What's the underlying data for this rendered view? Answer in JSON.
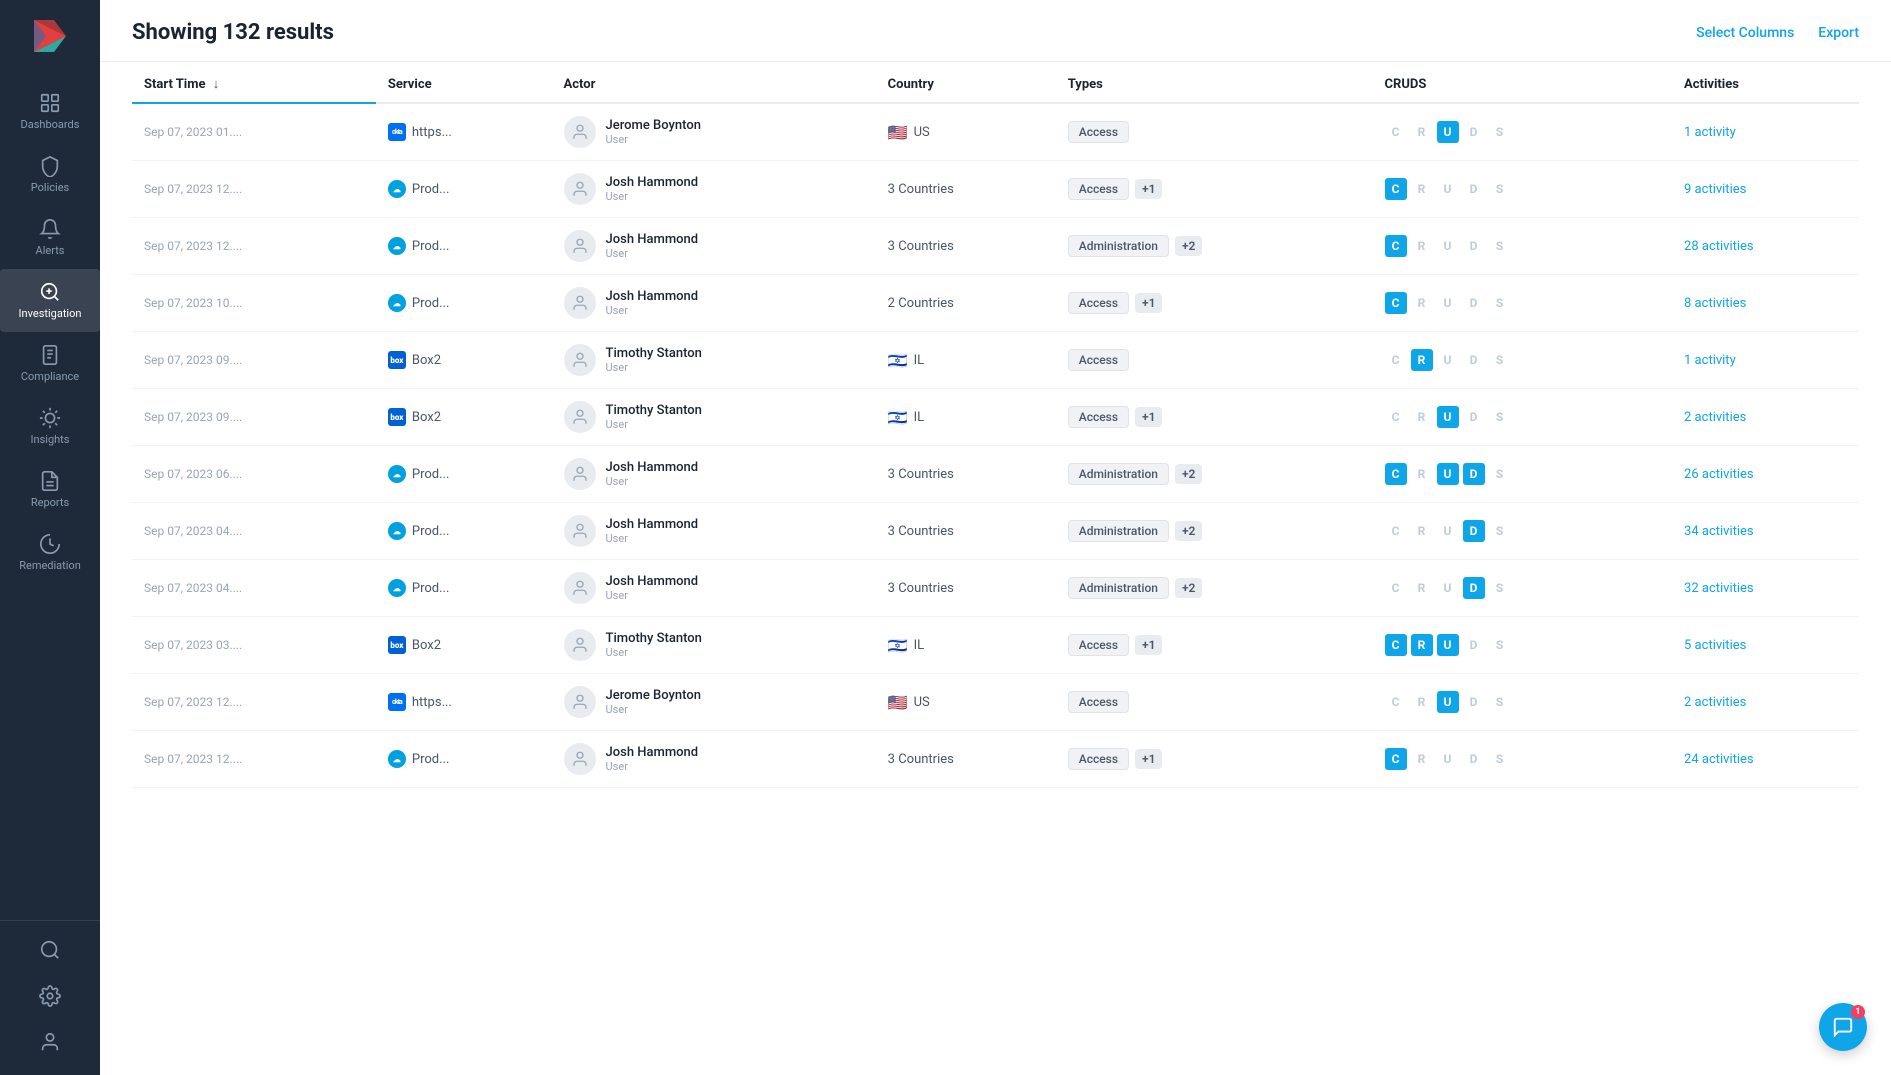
{
  "header": {
    "results_label": "Showing 132 results",
    "select_columns_label": "Select Columns",
    "export_label": "Export"
  },
  "columns": [
    "Start Time",
    "Service",
    "Actor",
    "Country",
    "Types",
    "CRUDS",
    "Activities"
  ],
  "sidebar": {
    "logo_text": "▶",
    "items": [
      {
        "id": "dashboards",
        "label": "Dashboards"
      },
      {
        "id": "policies",
        "label": "Policies"
      },
      {
        "id": "alerts",
        "label": "Alerts"
      },
      {
        "id": "investigation",
        "label": "Investigation",
        "active": true
      },
      {
        "id": "compliance",
        "label": "Compliance"
      },
      {
        "id": "insights",
        "label": "Insights"
      },
      {
        "id": "reports",
        "label": "Reports"
      },
      {
        "id": "remediation",
        "label": "Remediation"
      }
    ],
    "bottom_items": [
      {
        "id": "search",
        "label": ""
      },
      {
        "id": "settings",
        "label": ""
      },
      {
        "id": "profile",
        "label": ""
      }
    ]
  },
  "rows": [
    {
      "timestamp": "Sep 07, 2023 01....",
      "service_type": "okta",
      "service_name": "https...",
      "actor_name": "Jerome Boynton",
      "actor_role": "User",
      "country": "US",
      "flag": "🇺🇸",
      "types": [
        "Access"
      ],
      "types_extra": null,
      "cruds": {
        "C": false,
        "R": false,
        "U": true,
        "D": false,
        "S": false
      },
      "activities": "1 activity"
    },
    {
      "timestamp": "Sep 07, 2023 12....",
      "service_type": "salesforce",
      "service_name": "Prod...",
      "actor_name": "Josh Hammond",
      "actor_role": "User",
      "country": "3 Countries",
      "flag": null,
      "types": [
        "Access"
      ],
      "types_extra": "+1",
      "cruds": {
        "C": true,
        "R": false,
        "U": false,
        "D": false,
        "S": false
      },
      "activities": "9 activities"
    },
    {
      "timestamp": "Sep 07, 2023 12....",
      "service_type": "salesforce",
      "service_name": "Prod...",
      "actor_name": "Josh Hammond",
      "actor_role": "User",
      "country": "3 Countries",
      "flag": null,
      "types": [
        "Administration"
      ],
      "types_extra": "+2",
      "cruds": {
        "C": true,
        "R": false,
        "U": false,
        "D": false,
        "S": false
      },
      "activities": "28 activities"
    },
    {
      "timestamp": "Sep 07, 2023 10....",
      "service_type": "salesforce",
      "service_name": "Prod...",
      "actor_name": "Josh Hammond",
      "actor_role": "User",
      "country": "2 Countries",
      "flag": null,
      "types": [
        "Access"
      ],
      "types_extra": "+1",
      "cruds": {
        "C": true,
        "R": false,
        "U": false,
        "D": false,
        "S": false
      },
      "activities": "8 activities"
    },
    {
      "timestamp": "Sep 07, 2023 09....",
      "service_type": "box",
      "service_name": "Box2",
      "actor_name": "Timothy Stanton",
      "actor_role": "User",
      "country": "IL",
      "flag": "🇮🇱",
      "types": [
        "Access"
      ],
      "types_extra": null,
      "cruds": {
        "C": false,
        "R": true,
        "U": false,
        "D": false,
        "S": false
      },
      "activities": "1 activity"
    },
    {
      "timestamp": "Sep 07, 2023 09....",
      "service_type": "box",
      "service_name": "Box2",
      "actor_name": "Timothy Stanton",
      "actor_role": "User",
      "country": "IL",
      "flag": "🇮🇱",
      "types": [
        "Access"
      ],
      "types_extra": "+1",
      "cruds": {
        "C": false,
        "R": false,
        "U": true,
        "D": false,
        "S": false
      },
      "activities": "2 activities"
    },
    {
      "timestamp": "Sep 07, 2023 06....",
      "service_type": "salesforce",
      "service_name": "Prod...",
      "actor_name": "Josh Hammond",
      "actor_role": "User",
      "country": "3 Countries",
      "flag": null,
      "types": [
        "Administration"
      ],
      "types_extra": "+2",
      "cruds": {
        "C": true,
        "R": false,
        "U": true,
        "D": true,
        "S": false
      },
      "activities": "26 activities"
    },
    {
      "timestamp": "Sep 07, 2023 04....",
      "service_type": "salesforce",
      "service_name": "Prod...",
      "actor_name": "Josh Hammond",
      "actor_role": "User",
      "country": "3 Countries",
      "flag": null,
      "types": [
        "Administration"
      ],
      "types_extra": "+2",
      "cruds": {
        "C": false,
        "R": false,
        "U": false,
        "D": true,
        "S": false
      },
      "activities": "34 activities"
    },
    {
      "timestamp": "Sep 07, 2023 04....",
      "service_type": "salesforce",
      "service_name": "Prod...",
      "actor_name": "Josh Hammond",
      "actor_role": "User",
      "country": "3 Countries",
      "flag": null,
      "types": [
        "Administration"
      ],
      "types_extra": "+2",
      "cruds": {
        "C": false,
        "R": false,
        "U": false,
        "D": true,
        "S": false
      },
      "activities": "32 activities"
    },
    {
      "timestamp": "Sep 07, 2023 03....",
      "service_type": "box",
      "service_name": "Box2",
      "actor_name": "Timothy Stanton",
      "actor_role": "User",
      "country": "IL",
      "flag": "🇮🇱",
      "types": [
        "Access"
      ],
      "types_extra": "+1",
      "cruds": {
        "C": true,
        "R": true,
        "U": true,
        "D": false,
        "S": false
      },
      "activities": "5 activities"
    },
    {
      "timestamp": "Sep 07, 2023 12....",
      "service_type": "okta",
      "service_name": "https...",
      "actor_name": "Jerome Boynton",
      "actor_role": "User",
      "country": "US",
      "flag": "🇺🇸",
      "types": [
        "Access"
      ],
      "types_extra": null,
      "cruds": {
        "C": false,
        "R": false,
        "U": true,
        "D": false,
        "S": false
      },
      "activities": "2 activities"
    },
    {
      "timestamp": "Sep 07, 2023 12....",
      "service_type": "salesforce",
      "service_name": "Prod...",
      "actor_name": "Josh Hammond",
      "actor_role": "User",
      "country": "3 Countries",
      "flag": null,
      "types": [
        "Access"
      ],
      "types_extra": "+1",
      "cruds": {
        "C": true,
        "R": false,
        "U": false,
        "D": false,
        "S": false
      },
      "activities": "24 activities"
    }
  ],
  "chat": {
    "badge_count": "1"
  }
}
